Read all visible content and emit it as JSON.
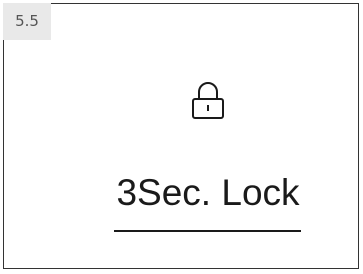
{
  "step": {
    "label": "5.5"
  },
  "display": {
    "icon": "lock-icon",
    "status_text": "3Sec. Lock"
  }
}
